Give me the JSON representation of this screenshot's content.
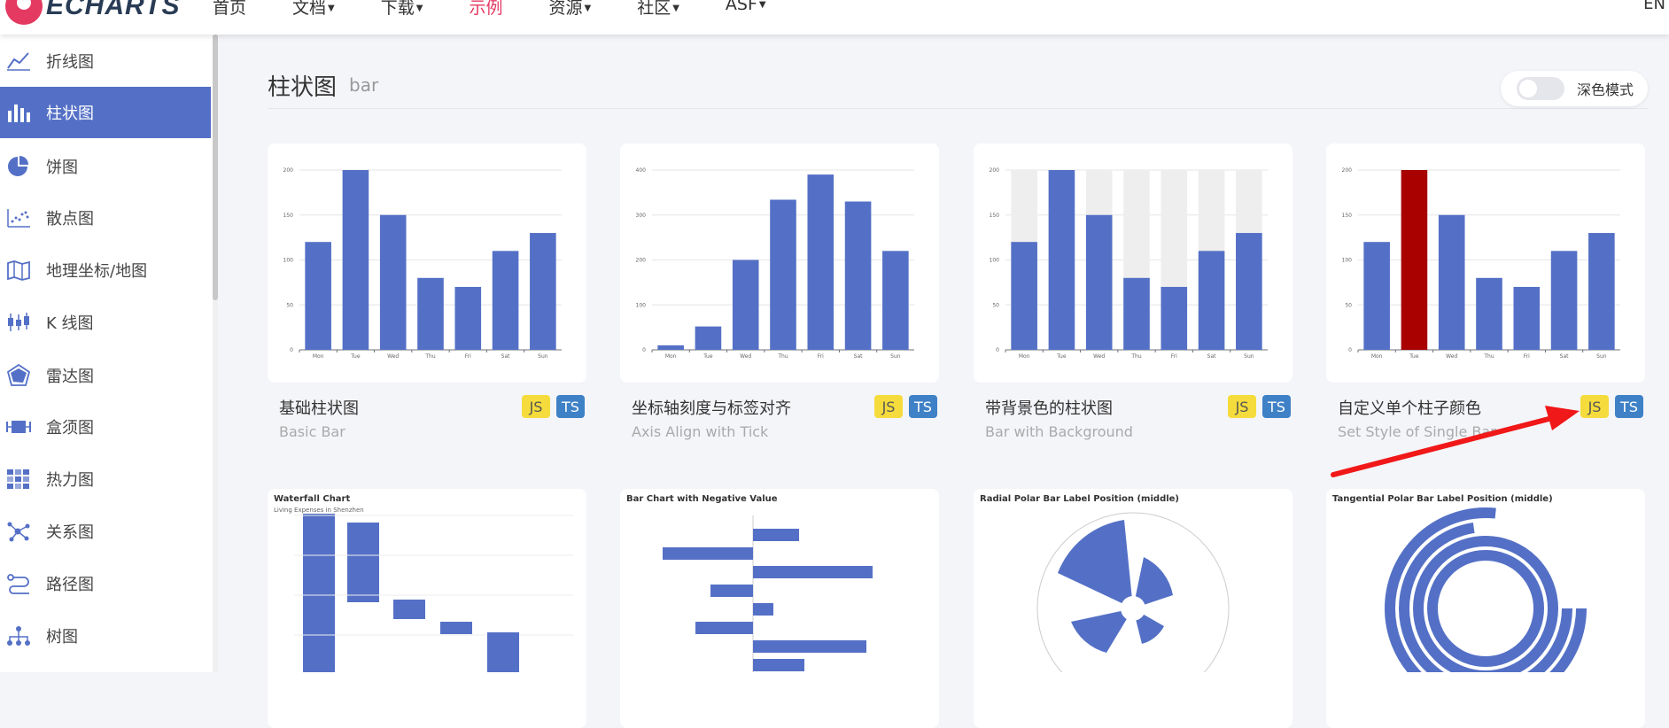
{
  "header": {
    "logo_text": "ECHARTS",
    "nav": [
      {
        "label": "首页",
        "caret": false
      },
      {
        "label": "文档",
        "caret": true
      },
      {
        "label": "下载",
        "caret": true
      },
      {
        "label": "示例",
        "caret": false,
        "active": true
      },
      {
        "label": "资源",
        "caret": true
      },
      {
        "label": "社区",
        "caret": true
      },
      {
        "label": "ASF",
        "caret": true
      }
    ],
    "lang": "EN"
  },
  "sidebar": {
    "items": [
      {
        "label": "折线图",
        "icon": "line-chart-icon"
      },
      {
        "label": "柱状图",
        "icon": "bar-chart-icon",
        "active": true
      },
      {
        "label": "饼图",
        "icon": "pie-chart-icon"
      },
      {
        "label": "散点图",
        "icon": "scatter-chart-icon"
      },
      {
        "label": "地理坐标/地图",
        "icon": "map-icon"
      },
      {
        "label": "K 线图",
        "icon": "candlestick-icon"
      },
      {
        "label": "雷达图",
        "icon": "radar-icon"
      },
      {
        "label": "盒须图",
        "icon": "boxplot-icon"
      },
      {
        "label": "热力图",
        "icon": "heatmap-icon"
      },
      {
        "label": "关系图",
        "icon": "graph-icon"
      },
      {
        "label": "路径图",
        "icon": "lines-icon"
      },
      {
        "label": "树图",
        "icon": "tree-icon"
      }
    ]
  },
  "main": {
    "title": "柱状图",
    "subtitle": "bar",
    "dark_mode_label": "深色模式",
    "badges": {
      "js": "JS",
      "ts": "TS"
    },
    "examples": [
      {
        "title": "基础柱状图",
        "subtitle": "Basic Bar"
      },
      {
        "title": "坐标轴刻度与标签对齐",
        "subtitle": "Axis Align with Tick"
      },
      {
        "title": "带背景色的柱状图",
        "subtitle": "Bar with Background"
      },
      {
        "title": "自定义单个柱子颜色",
        "subtitle": "Set Style of Single Bar"
      }
    ],
    "row2_titles": [
      {
        "title": "Waterfall Chart",
        "subtitle": "Living Expenses in Shenzhen"
      },
      {
        "title": "Bar Chart with Negative Value"
      },
      {
        "title": "Radial Polar Bar Label Position (middle)"
      },
      {
        "title": "Tangential Polar Bar Label Position (middle)"
      }
    ]
  },
  "colors": {
    "accent": "#5470c6",
    "highlight": "#a90000",
    "nav_active": "#e43961",
    "annotation": "#f01818"
  },
  "chart_data": [
    {
      "type": "bar",
      "categories": [
        "Mon",
        "Tue",
        "Wed",
        "Thu",
        "Fri",
        "Sat",
        "Sun"
      ],
      "values": [
        120,
        200,
        150,
        80,
        70,
        110,
        130
      ],
      "ylim": [
        0,
        200
      ],
      "yticks": [
        "0",
        "50",
        "100",
        "150",
        "200"
      ]
    },
    {
      "type": "bar",
      "categories": [
        "Mon",
        "Tue",
        "Wed",
        "Thu",
        "Fri",
        "Sat",
        "Sun"
      ],
      "values": [
        10,
        52,
        200,
        334,
        390,
        330,
        220
      ],
      "ylim": [
        0,
        400
      ],
      "yticks": [
        "0",
        "100",
        "200",
        "300",
        "400"
      ]
    },
    {
      "type": "bar",
      "categories": [
        "Mon",
        "Tue",
        "Wed",
        "Thu",
        "Fri",
        "Sat",
        "Sun"
      ],
      "values": [
        120,
        200,
        150,
        80,
        70,
        110,
        130
      ],
      "background": true,
      "ylim": [
        0,
        200
      ],
      "yticks": [
        "0",
        "50",
        "100",
        "150",
        "200"
      ]
    },
    {
      "type": "bar",
      "categories": [
        "Mon",
        "Tue",
        "Wed",
        "Thu",
        "Fri",
        "Sat",
        "Sun"
      ],
      "values": [
        120,
        200,
        150,
        80,
        70,
        110,
        130
      ],
      "highlight_index": 1,
      "ylim": [
        0,
        200
      ],
      "yticks": [
        "0",
        "50",
        "100",
        "150",
        "200"
      ]
    }
  ]
}
